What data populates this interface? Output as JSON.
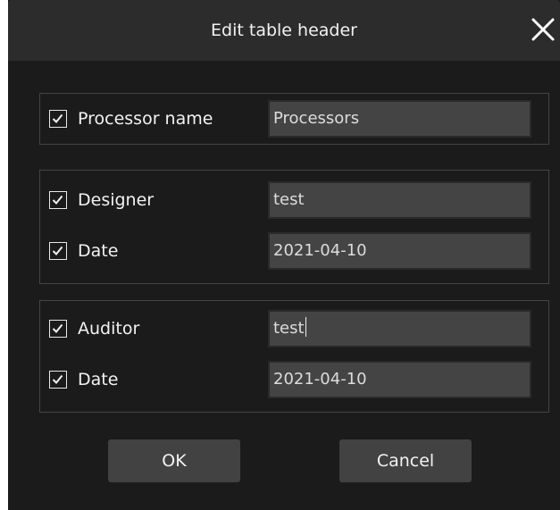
{
  "dialog": {
    "title": "Edit table header",
    "close_icon": "close-icon",
    "colors": {
      "background": "#1b1b1b",
      "titlebar": "#2c2c2c",
      "field": "#444444",
      "button": "#424242",
      "text": "#f2f2f2"
    }
  },
  "processor_group": {
    "processor_name": {
      "checked": true,
      "label": "Processor name",
      "value": "Processors"
    }
  },
  "designer_group": {
    "designer": {
      "checked": true,
      "label": "Designer",
      "value": "test"
    },
    "date": {
      "checked": true,
      "label": "Date",
      "value": "2021-04-10"
    }
  },
  "auditor_group": {
    "auditor": {
      "checked": true,
      "label": "Auditor",
      "value": "test",
      "focused": true
    },
    "date": {
      "checked": true,
      "label": "Date",
      "value": "2021-04-10"
    }
  },
  "buttons": {
    "ok_label": "OK",
    "cancel_label": "Cancel"
  }
}
